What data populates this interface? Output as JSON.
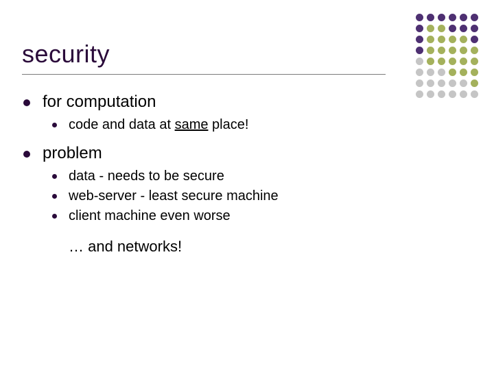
{
  "title": "security",
  "bullets": [
    {
      "label": "for computation",
      "children": [
        {
          "pre": "code and data at ",
          "underlined": "same",
          "post": " place!"
        }
      ]
    },
    {
      "label": "problem",
      "children": [
        {
          "text": "data - needs to be secure"
        },
        {
          "text": "web-server - least secure machine"
        },
        {
          "text": "client machine even worse"
        }
      ],
      "trailer": "…  and networks!"
    }
  ],
  "dot_colors": {
    "purple": "#3b1a63",
    "olive": "#9aa84a",
    "grey": "#bfbfbf"
  },
  "dot_pattern": [
    [
      "purple",
      "purple",
      "purple",
      "purple",
      "purple",
      "purple"
    ],
    [
      "purple",
      "olive",
      "olive",
      "purple",
      "purple",
      "purple"
    ],
    [
      "purple",
      "olive",
      "olive",
      "olive",
      "olive",
      "purple"
    ],
    [
      "purple",
      "olive",
      "olive",
      "olive",
      "olive",
      "olive"
    ],
    [
      "grey",
      "olive",
      "olive",
      "olive",
      "olive",
      "olive"
    ],
    [
      "grey",
      "grey",
      "grey",
      "olive",
      "olive",
      "olive"
    ],
    [
      "grey",
      "grey",
      "grey",
      "grey",
      "grey",
      "olive"
    ],
    [
      "grey",
      "grey",
      "grey",
      "grey",
      "grey",
      "grey"
    ]
  ]
}
